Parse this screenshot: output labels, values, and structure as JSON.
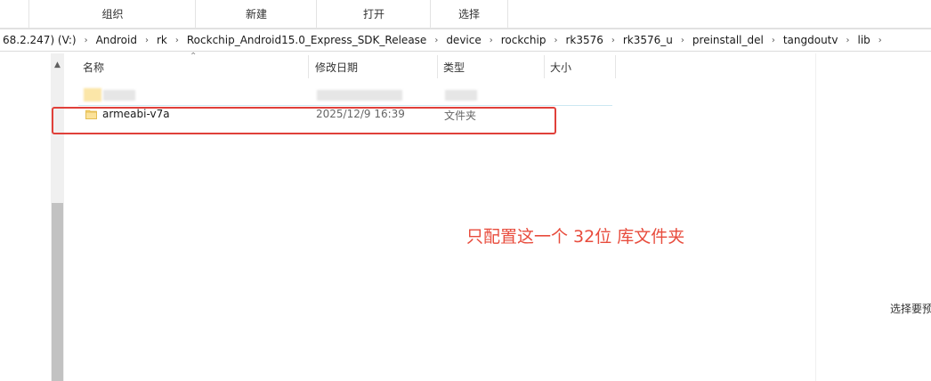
{
  "ribbon": {
    "groups": [
      "组织",
      "新建",
      "打开",
      "选择"
    ]
  },
  "address": {
    "crumbs": [
      "68.2.247) (V:)",
      "Android",
      "rk",
      "Rockchip_Android15.0_Express_SDK_Release",
      "device",
      "rockchip",
      "rk3576",
      "rk3576_u",
      "preinstall_del",
      "tangdoutv",
      "lib"
    ]
  },
  "columns": {
    "name": "名称",
    "modified": "修改日期",
    "type": "类型",
    "size": "大小"
  },
  "files": [
    {
      "name": "armeabi-v7a",
      "modified": "2025/12/9 16:39",
      "type": "文件夹",
      "icon": "folder-icon"
    }
  ],
  "annotation": {
    "text": "只配置这一个 32位 库文件夹",
    "color": "#e84c3d"
  },
  "preview_pane": {
    "text": "选择要预"
  },
  "colors": {
    "highlight": "#e0403a",
    "folder": "#f8d775"
  }
}
